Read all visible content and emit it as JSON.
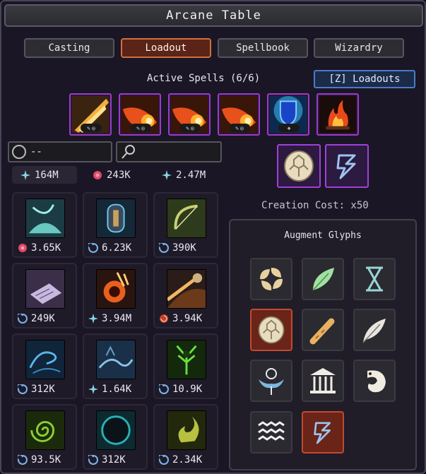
{
  "window": {
    "title": "Arcane Table"
  },
  "tabs": [
    {
      "label": "Casting",
      "active": false
    },
    {
      "label": "Loadout",
      "active": true
    },
    {
      "label": "Spellbook",
      "active": false
    },
    {
      "label": "Wizardry",
      "active": false
    }
  ],
  "active_spells": {
    "label": "Active Spells (6/6)",
    "loadouts_button": "[Z] Loadouts",
    "slots": [
      {
        "icon": "light-beam-icon"
      },
      {
        "icon": "fireball-icon"
      },
      {
        "icon": "fireball-icon"
      },
      {
        "icon": "fireball-icon"
      },
      {
        "icon": "blue-shield-icon"
      },
      {
        "icon": "campfire-icon"
      }
    ]
  },
  "filter": {
    "value": "--"
  },
  "search": {
    "placeholder": ""
  },
  "selected_glyphs": [
    {
      "icon": "turtle-shell-icon"
    },
    {
      "icon": "lightning-bolt-icon"
    }
  ],
  "creation_cost": "Creation Cost: x50",
  "inventory_top_row": [
    {
      "currency_icon": "star-burst-icon",
      "amount": "164M"
    },
    {
      "currency_icon": "flower-icon",
      "amount": "243K"
    },
    {
      "currency_icon": "star-burst-icon",
      "amount": "2.47M"
    }
  ],
  "inventory": [
    {
      "icon": "water-splash-icon",
      "currency_icon": "flower-icon",
      "amount": "3.65K"
    },
    {
      "icon": "blue-portal-icon",
      "currency_icon": "swirl-icon",
      "amount": "6.23K"
    },
    {
      "icon": "bow-icon",
      "currency_icon": "swirl-icon",
      "amount": "390K"
    },
    {
      "icon": "scroll-icon",
      "currency_icon": "swirl-icon",
      "amount": "249K"
    },
    {
      "icon": "fire-explosion-icon",
      "currency_icon": "star-burst-icon",
      "amount": "3.94M"
    },
    {
      "icon": "meteor-icon",
      "currency_icon": "fire-spiral-icon",
      "amount": "3.94K"
    },
    {
      "icon": "blue-wind-icon",
      "currency_icon": "swirl-icon",
      "amount": "312K"
    },
    {
      "icon": "blue-wave-icon",
      "currency_icon": "star-burst-icon",
      "amount": "1.64K"
    },
    {
      "icon": "forest-spirit-icon",
      "currency_icon": "swirl-icon",
      "amount": "10.9K"
    },
    {
      "icon": "green-spiral-icon",
      "currency_icon": "swirl-icon",
      "amount": "93.5K"
    },
    {
      "icon": "dark-orb-icon",
      "currency_icon": "swirl-icon",
      "amount": "312K"
    },
    {
      "icon": "green-flame-icon",
      "currency_icon": "swirl-icon",
      "amount": "2.34K"
    }
  ],
  "augment_glyphs": {
    "title": "Augment Glyphs",
    "items": [
      {
        "icon": "swirl-glyph-icon",
        "selected": false
      },
      {
        "icon": "leaf-icon",
        "selected": false
      },
      {
        "icon": "hourglass-icon",
        "selected": false
      },
      {
        "icon": "turtle-shell-icon",
        "selected": true
      },
      {
        "icon": "spyglass-icon",
        "selected": false
      },
      {
        "icon": "feather-icon",
        "selected": false
      },
      {
        "icon": "winged-emblem-icon",
        "selected": false
      },
      {
        "icon": "temple-icon",
        "selected": false
      },
      {
        "icon": "grub-icon",
        "selected": false
      },
      {
        "icon": "waves-icon",
        "selected": false
      },
      {
        "icon": "lightning-bolt-icon",
        "selected": true
      }
    ]
  },
  "colors": {
    "panel_bg": "#1a1625",
    "tab_active": "#5a2418",
    "slot_border": "#9a3cc8",
    "loadouts_accent": "#4c7ac8",
    "glyph_selected": "#6a2418"
  }
}
